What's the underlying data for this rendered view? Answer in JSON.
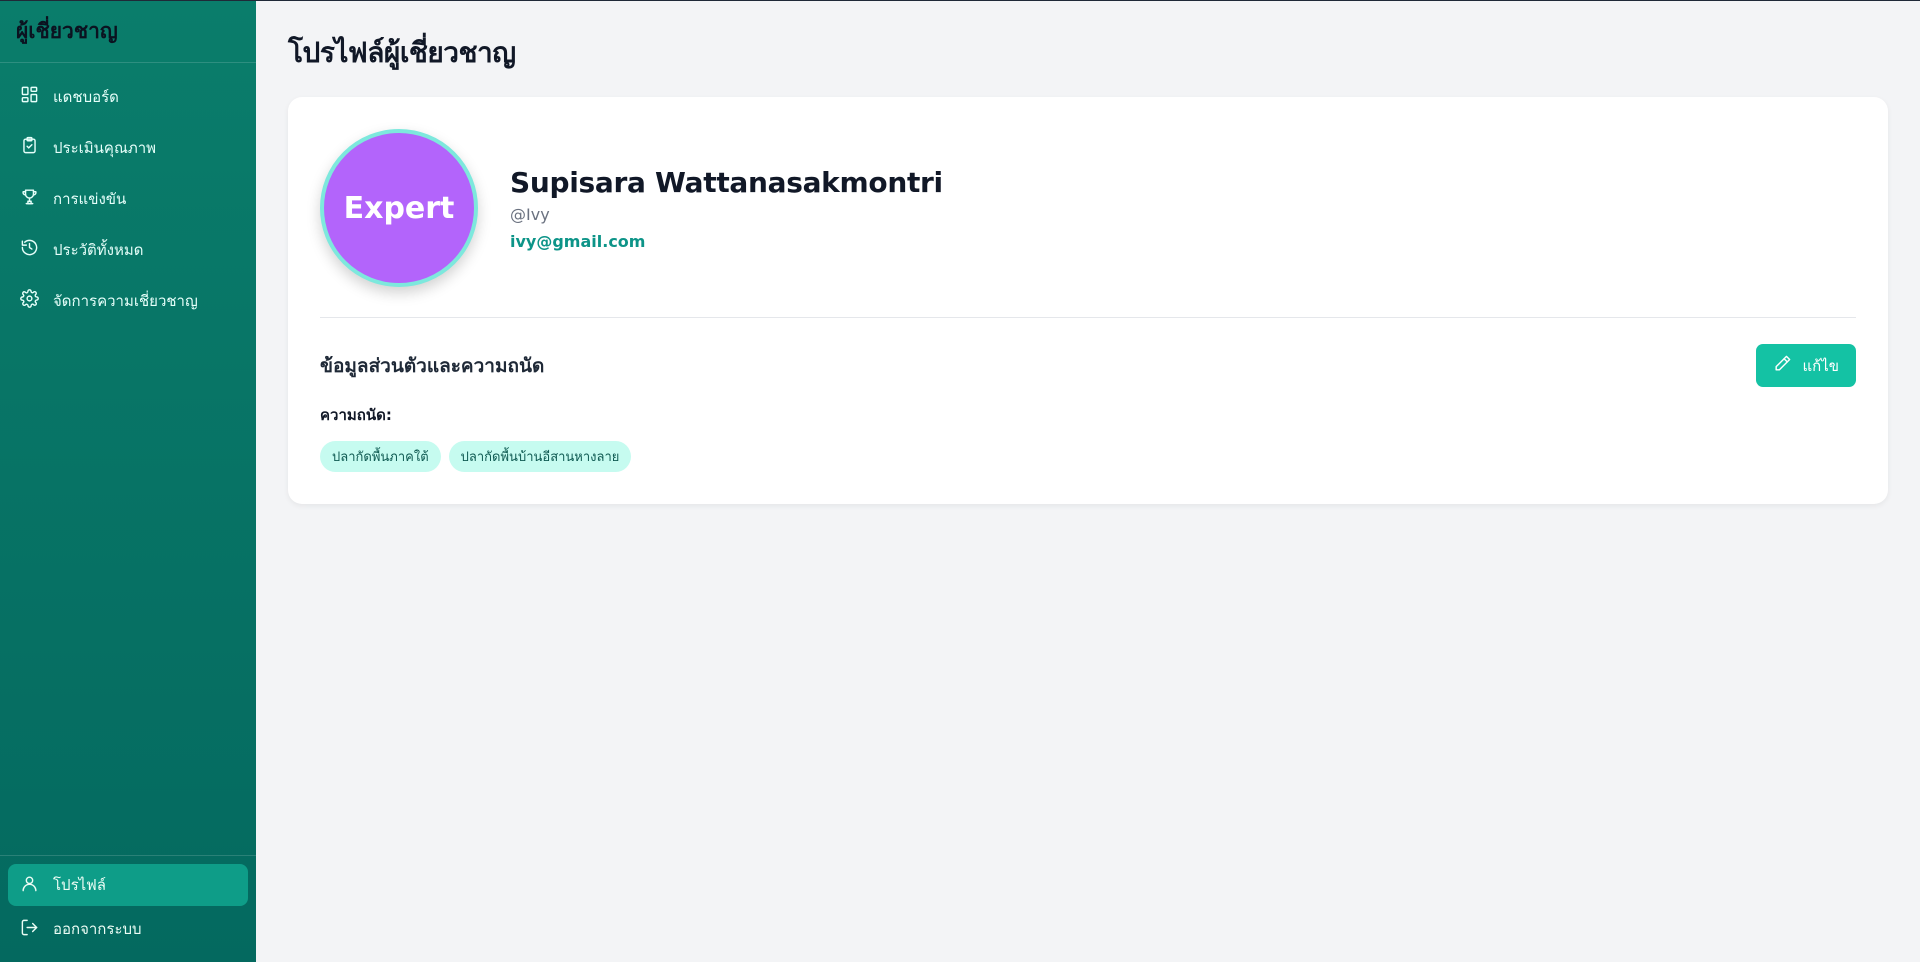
{
  "sidebar": {
    "brand": "ผู้เชี่ยวชาญ",
    "items": [
      {
        "label": "แดชบอร์ด",
        "icon": "dashboard-icon"
      },
      {
        "label": "ประเมินคุณภาพ",
        "icon": "clipboard-check-icon"
      },
      {
        "label": "การแข่งขัน",
        "icon": "trophy-icon"
      },
      {
        "label": "ประวัติทั้งหมด",
        "icon": "history-icon"
      },
      {
        "label": "จัดการความเชี่ยวชาญ",
        "icon": "gear-icon"
      }
    ],
    "bottom": [
      {
        "label": "โปรไฟล์",
        "icon": "user-icon",
        "active": true
      },
      {
        "label": "ออกจากระบบ",
        "icon": "logout-icon",
        "active": false
      }
    ]
  },
  "main": {
    "title": "โปรไฟล์ผู้เชี่ยวชาญ",
    "profile": {
      "avatar_text": "Expert",
      "name": "Supisara Wattanasakmontri",
      "username": "@Ivy",
      "email": "ivy@gmail.com"
    },
    "section": {
      "title": "ข้อมูลส่วนตัวและความถนัด",
      "edit_label": "แก้ไข",
      "skills_label": "ความถนัด:",
      "skills": [
        "ปลากัดพื้นภาคใต้",
        "ปลากัดพื้นบ้านอีสานหางลาย"
      ]
    }
  },
  "colors": {
    "sidebar_bg": "#0a7d6b",
    "active_item": "#0e9d88",
    "accent": "#14c2a4",
    "avatar_bg": "#b364fb",
    "avatar_ring": "#7de8dd",
    "tag_bg": "#c6fbf0"
  }
}
